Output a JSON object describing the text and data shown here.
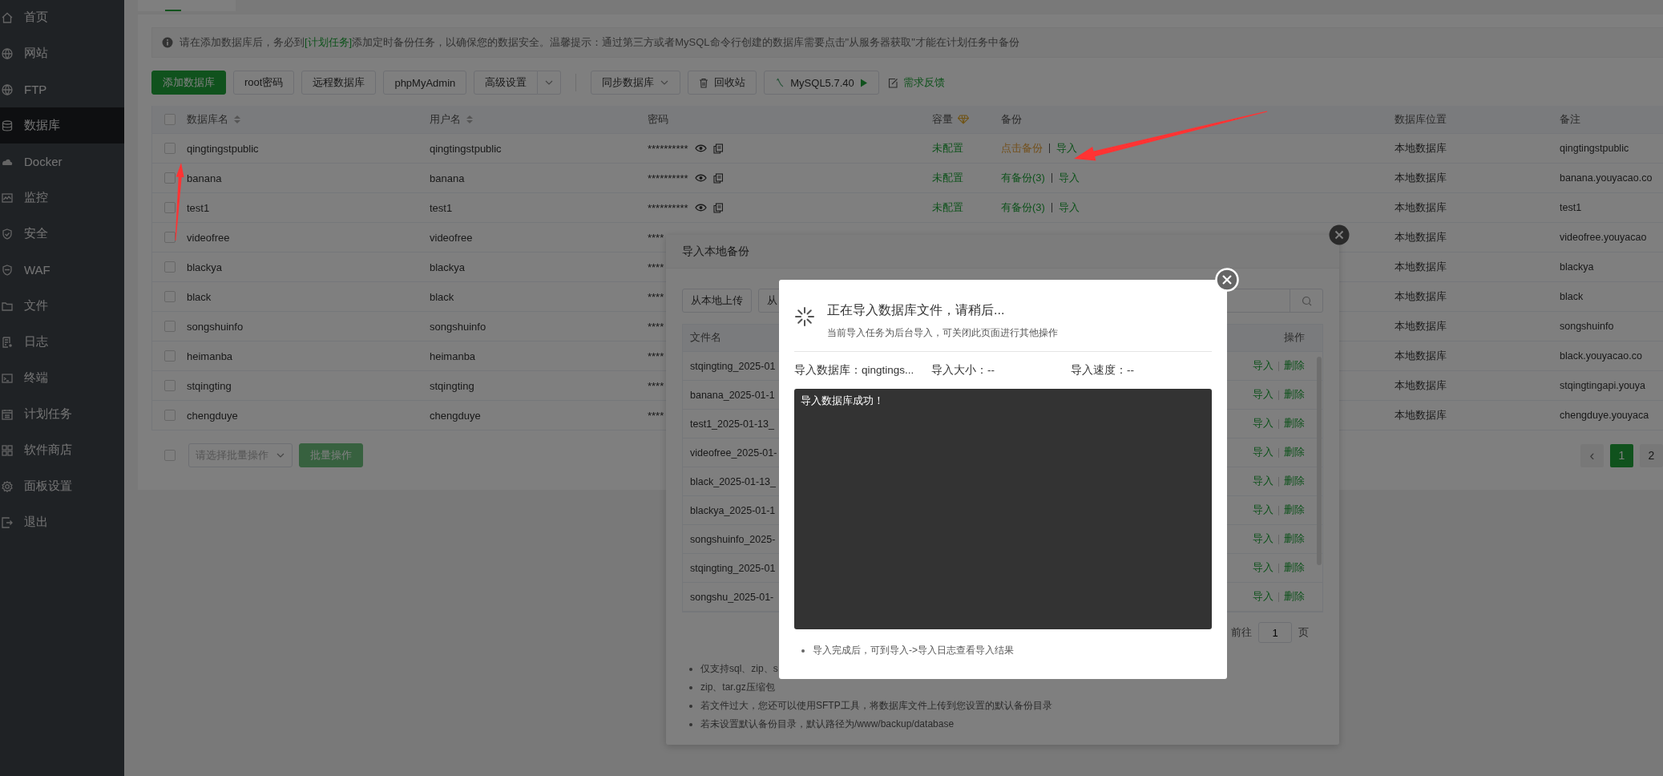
{
  "sidebar": {
    "items": [
      {
        "label": "首页",
        "selected": false
      },
      {
        "label": "网站",
        "selected": false
      },
      {
        "label": "FTP",
        "selected": false
      },
      {
        "label": "数据库",
        "selected": true
      },
      {
        "label": "Docker",
        "selected": false
      },
      {
        "label": "监控",
        "selected": false
      },
      {
        "label": "安全",
        "selected": false
      },
      {
        "label": "WAF",
        "selected": false
      },
      {
        "label": "文件",
        "selected": false
      },
      {
        "label": "日志",
        "selected": false
      },
      {
        "label": "终端",
        "selected": false
      },
      {
        "label": "计划任务",
        "selected": false
      },
      {
        "label": "软件商店",
        "selected": false
      },
      {
        "label": "面板设置",
        "selected": false
      },
      {
        "label": "退出",
        "selected": false
      }
    ]
  },
  "tab_bar": {
    "tabs": [
      {
        "selected": true
      }
    ]
  },
  "notice": {
    "text_before": "请在添加数据库后，务必到",
    "link": "[计划任务]",
    "text_after": "添加定时备份任务，以确保您的数据安全。温馨提示：通过第三方或者MySQL命令行创建的数据库需要点击\"从服务器获取\"才能在计划任务中备份"
  },
  "toolbar": {
    "buttons": [
      {
        "label": "添加数据库",
        "kind": "primary"
      },
      {
        "label": "root密码",
        "kind": "plain"
      },
      {
        "label": "远程数据库",
        "kind": "plain"
      },
      {
        "label": "phpMyAdmin",
        "kind": "plain"
      },
      {
        "label": "高级设置",
        "kind": "split"
      },
      {
        "label": "同步数据库",
        "kind": "dropdown"
      },
      {
        "label": "回收站",
        "kind": "trash"
      },
      {
        "label": "MySQL5.7.40",
        "kind": "version"
      },
      {
        "label": "需求反馈",
        "kind": "feedback"
      }
    ]
  },
  "table": {
    "header_checked": false,
    "columns": [
      {
        "label": "数据库名",
        "kind": "sort"
      },
      {
        "label": "用户名",
        "kind": "sort"
      },
      {
        "label": "密码",
        "kind": "plain"
      },
      {
        "label": "容量",
        "kind": "vip"
      },
      {
        "label": "备份",
        "kind": "plain"
      },
      {
        "label": "数据库位置",
        "kind": "plain"
      },
      {
        "label": "备注",
        "kind": "plain"
      }
    ],
    "rows": [
      {
        "kind": "full",
        "checked": false,
        "name": "qingtingstpublic",
        "user": "qingtingstpublic",
        "password": "**********",
        "capacity": "未配置",
        "backup": {
          "text": "点击备份",
          "kind": "prompt"
        },
        "import": "导入",
        "location": "本地数据库",
        "note": "qingtingstpublic"
      },
      {
        "kind": "full",
        "checked": false,
        "name": "banana",
        "user": "banana",
        "password": "**********",
        "capacity": "未配置",
        "backup": {
          "text": "有备份(3)",
          "kind": "existing"
        },
        "import": "导入",
        "location": "本地数据库",
        "note": "banana.youyacao.co"
      },
      {
        "kind": "full",
        "checked": false,
        "name": "test1",
        "user": "test1",
        "password": "**********",
        "capacity": "未配置",
        "backup": {
          "text": "有备份(3)",
          "kind": "existing"
        },
        "import": "导入",
        "location": "本地数据库",
        "note": "test1"
      },
      {
        "kind": "covered",
        "checked": false,
        "name": "videofree",
        "user": "videofree",
        "password": "****",
        "location": "本地数据库",
        "note": "videofree.youyacao"
      },
      {
        "kind": "covered",
        "checked": false,
        "name": "blackya",
        "user": "blackya",
        "password": "****",
        "location": "本地数据库",
        "note": "blackya"
      },
      {
        "kind": "covered",
        "checked": false,
        "name": "black",
        "user": "black",
        "password": "****",
        "location": "本地数据库",
        "note": "black"
      },
      {
        "kind": "covered",
        "checked": false,
        "name": "songshuinfo",
        "user": "songshuinfo",
        "password": "****",
        "location": "本地数据库",
        "note": "songshuinfo"
      },
      {
        "kind": "covered",
        "checked": false,
        "name": "heimanba",
        "user": "heimanba",
        "password": "****",
        "location": "本地数据库",
        "note": "black.youyacao.co"
      },
      {
        "kind": "covered",
        "checked": false,
        "name": "stqingting",
        "user": "stqingting",
        "password": "****",
        "location": "本地数据库",
        "note": "stqingtingapi.youya"
      },
      {
        "kind": "covered",
        "checked": false,
        "name": "chengduye",
        "user": "chengduye",
        "password": "****",
        "location": "本地数据库",
        "note": "chengduye.youyaca"
      }
    ]
  },
  "batch": {
    "checked": false,
    "placeholder": "请选择批量操作",
    "button": "批量操作"
  },
  "pagination": {
    "prev": "‹",
    "pages": [
      {
        "label": "1",
        "selected": true
      },
      {
        "label": "2",
        "selected": false
      }
    ]
  },
  "import_dialog": {
    "title": "导入本地备份",
    "buttons": [
      {
        "label": "从本地上传"
      },
      {
        "label": "从"
      }
    ],
    "columns": [
      "文件名",
      "操作"
    ],
    "files": [
      {
        "name": "stqingting_2025-01",
        "actions": [
          "导入",
          "删除"
        ]
      },
      {
        "name": "banana_2025-01-1",
        "actions": [
          "导入",
          "删除"
        ]
      },
      {
        "name": "test1_2025-01-13_",
        "actions": [
          "导入",
          "删除"
        ]
      },
      {
        "name": "videofree_2025-01-",
        "actions": [
          "导入",
          "删除"
        ]
      },
      {
        "name": "black_2025-01-13_",
        "actions": [
          "导入",
          "删除"
        ]
      },
      {
        "name": "blackya_2025-01-1",
        "actions": [
          "导入",
          "删除"
        ]
      },
      {
        "name": "songshuinfo_2025-",
        "actions": [
          "导入",
          "删除"
        ]
      },
      {
        "name": "stqingting_2025-01",
        "actions": [
          "导入",
          "删除"
        ]
      },
      {
        "name": "songshu_2025-01-",
        "actions": [
          "导入",
          "删除"
        ]
      }
    ],
    "pagination": {
      "goto": "前往",
      "page": "1",
      "suffix": "页"
    },
    "notes": [
      "仅支持sql、zip、s",
      "zip、tar.gz压缩包",
      "若文件过大，您还可以使用SFTP工具，将数据库文件上传到您设置的默认备份目录",
      "若未设置默认备份目录，默认路径为/www/backup/database"
    ]
  },
  "progress_dialog": {
    "title": "正在导入数据库文件，请稍后...",
    "subtitle": "当前导入任务为后台导入，可关闭此页面进行其他操作",
    "stats": [
      "导入数据库：qingtings...",
      "导入大小：--",
      "导入速度：--"
    ],
    "log": "导入数据库成功！",
    "notes": [
      "导入完成后，可到导入->导入日志查看导入结果"
    ]
  }
}
